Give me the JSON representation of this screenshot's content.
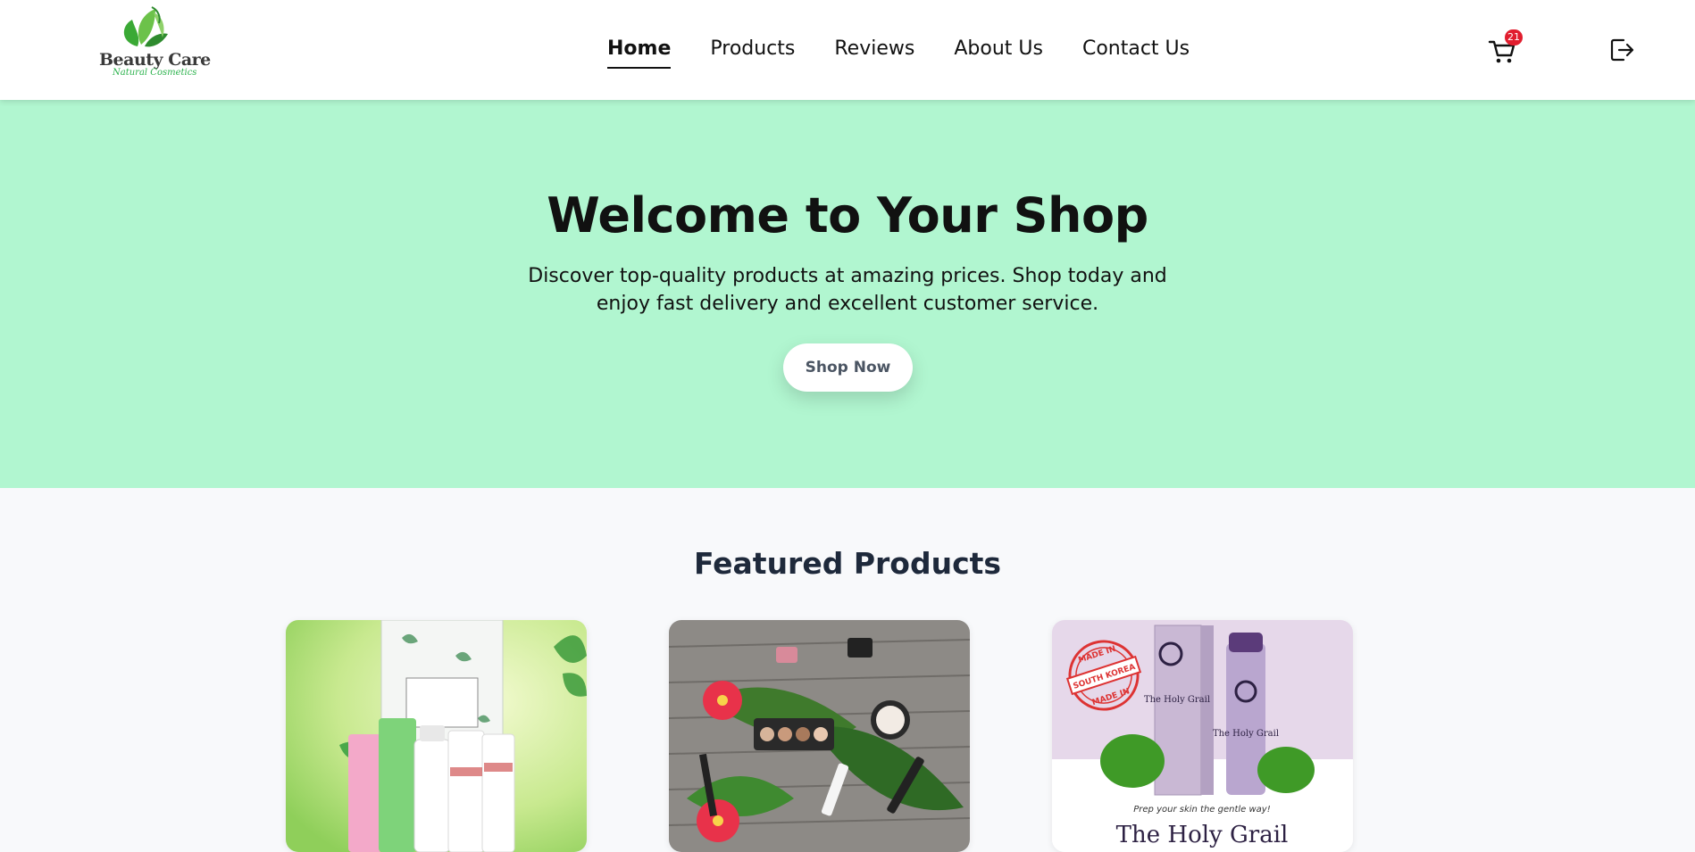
{
  "brand": {
    "name": "Beauty Care",
    "tagline": "Natural Cosmetics"
  },
  "nav": {
    "items": [
      {
        "label": "Home",
        "active": true
      },
      {
        "label": "Products"
      },
      {
        "label": "Reviews"
      },
      {
        "label": "About Us"
      },
      {
        "label": "Contact Us"
      }
    ]
  },
  "cart": {
    "count": "21",
    "icon": "cart-icon"
  },
  "logout": {
    "icon": "logout-icon"
  },
  "hero": {
    "title": "Welcome to Your Shop",
    "subtitle": "Discover top-quality products at amazing prices. Shop today and enjoy fast delivery and excellent customer service.",
    "cta": "Shop Now",
    "background": "#b1f6d0"
  },
  "featured": {
    "title": "Featured Products",
    "cards": [
      {
        "image": "skincare-set-image"
      },
      {
        "image": "makeup-flatlay-image"
      },
      {
        "image": "holy-grail-toner-image",
        "stamp_top": "MADE IN",
        "stamp_middle": "SOUTH KOREA",
        "stamp_bottom": "MADE IN",
        "product_name": "The Holy Grail",
        "caption": "Prep your skin the gentle way!",
        "headline": "The Holy Grail"
      }
    ]
  }
}
